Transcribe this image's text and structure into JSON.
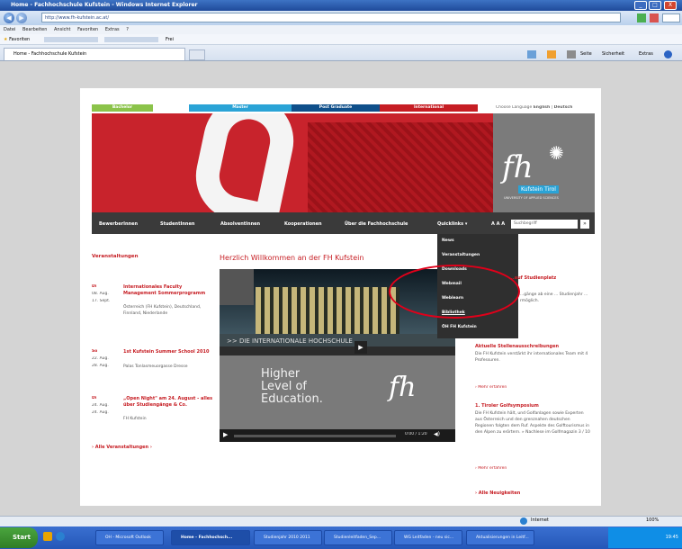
{
  "window": {
    "title": "Home - Fachhochschule Kufstein - Windows Internet Explorer",
    "min": "_",
    "max": "□",
    "close": "X"
  },
  "browser": {
    "url": "http://www.fh-kufstein.ac.at/",
    "menu": [
      "Datei",
      "Bearbeiten",
      "Ansicht",
      "Favoriten",
      "Extras",
      "?"
    ],
    "favorites_label": "Favoriten",
    "frei_label": "Frei",
    "tab_title": "Home - Fachhochschule Kufstein",
    "toolbar_items": [
      "Seite",
      "Sicherheit",
      "Extras"
    ]
  },
  "site": {
    "top_nav": [
      "Bachelor",
      "Master",
      "Post Graduate",
      "International"
    ],
    "lang": {
      "prefix": "Choose Language",
      "english": "English",
      "sep": "|",
      "deutsch": "Deutsch"
    },
    "logo": {
      "mark": "fh",
      "name": "Kufstein Tirol",
      "tag": "UNIVERSITY OF APPLIED SCIENCES"
    },
    "main_nav": [
      "BewerberInnen",
      "StudentInnen",
      "AbsolventInnen",
      "Kooperationen",
      "Über die Fachhochschule",
      "Quicklinks"
    ],
    "quick_arrow": "▾",
    "font_sizes": "A A A",
    "search": {
      "value": "Suchbegriff",
      "button": "»"
    },
    "quicklinks": [
      "News",
      "Veranstaltungen",
      "Downloads",
      "Webmail",
      "Weblearn",
      "Bibliothek",
      "ÖH FH Kufstein"
    ],
    "left": {
      "heading": "Veranstaltungen",
      "events": [
        {
          "day": "Di",
          "date1": "08. Aug.",
          "date2": "17. Sept.",
          "title": "Internationales Faculty Management Sommerprogramm",
          "desc": "Österreich (FH Kufstein), Deutschland, Finnland, Niederlande"
        },
        {
          "day": "So",
          "date1": "22. Aug.",
          "date2": "28. Aug.",
          "title": "1st Kufstein Summer School 2010",
          "desc": "Palas Tonlasmeuorgasse Dresse"
        },
        {
          "day": "Di",
          "date1": "24. Aug.",
          "date2": "24. Aug.",
          "title": "„Open Night\" am 24. August - alles über Studiengänge & Co.",
          "desc": "FH Kufstein"
        }
      ],
      "all": "› Alle Veranstaltungen ›"
    },
    "welcome": "Herzlich Willkommen an der FH Kufstein",
    "video": {
      "banner": ">> DIE INTERNATIONALE HOCHSCHULE",
      "line1": "Higher",
      "line2": "Level of",
      "line3": "Education.",
      "time": "0:00 / 1:20"
    },
    "right": {
      "item1_title": "...auf Studienplatz",
      "item1_text": "...gänge ab eine ... Studienjahr ... rmöglich.",
      "item2_title": "Aktuelle Stellenausschreibungen",
      "item2_text": "Die FH Kufstein verstärkt ihr internationales Team mit 4 Professuren.",
      "item2_more": "› Mehr erfahren",
      "item3_title": "1. Tiroler Golfsymposium",
      "item3_text": "Die FH Kufstein hält, und Golfanlagen sowie Experten aus Österreich und den grenznahen deutschen Regionen folgten dem Ruf. Aspekte des Golftourismus in den Alpen zu erörtern. » Nachlese im Golfmagazin 3 / 10",
      "item3_more": "› Mehr erfahren",
      "all_news": "› Alle Neuigkeiten"
    }
  },
  "status": {
    "zone": "Internet",
    "zoom": "100%"
  },
  "taskbar": {
    "start": "Start",
    "tasks": [
      "OH - Microsoft Outlook",
      "Home - Fachhochsch...",
      "Studienjahr 2010 2011",
      "Studienleitfaden_Sep...",
      "WG Leitfaden - neu sic...",
      "Aktualisierungen in Leitf..."
    ],
    "clock": "19:45"
  },
  "colors": {
    "green": "#8bc34a",
    "blue": "#2aa3d6",
    "navy": "#0f4f8a",
    "red": "#c61d23",
    "annotation": "#e0001a"
  }
}
